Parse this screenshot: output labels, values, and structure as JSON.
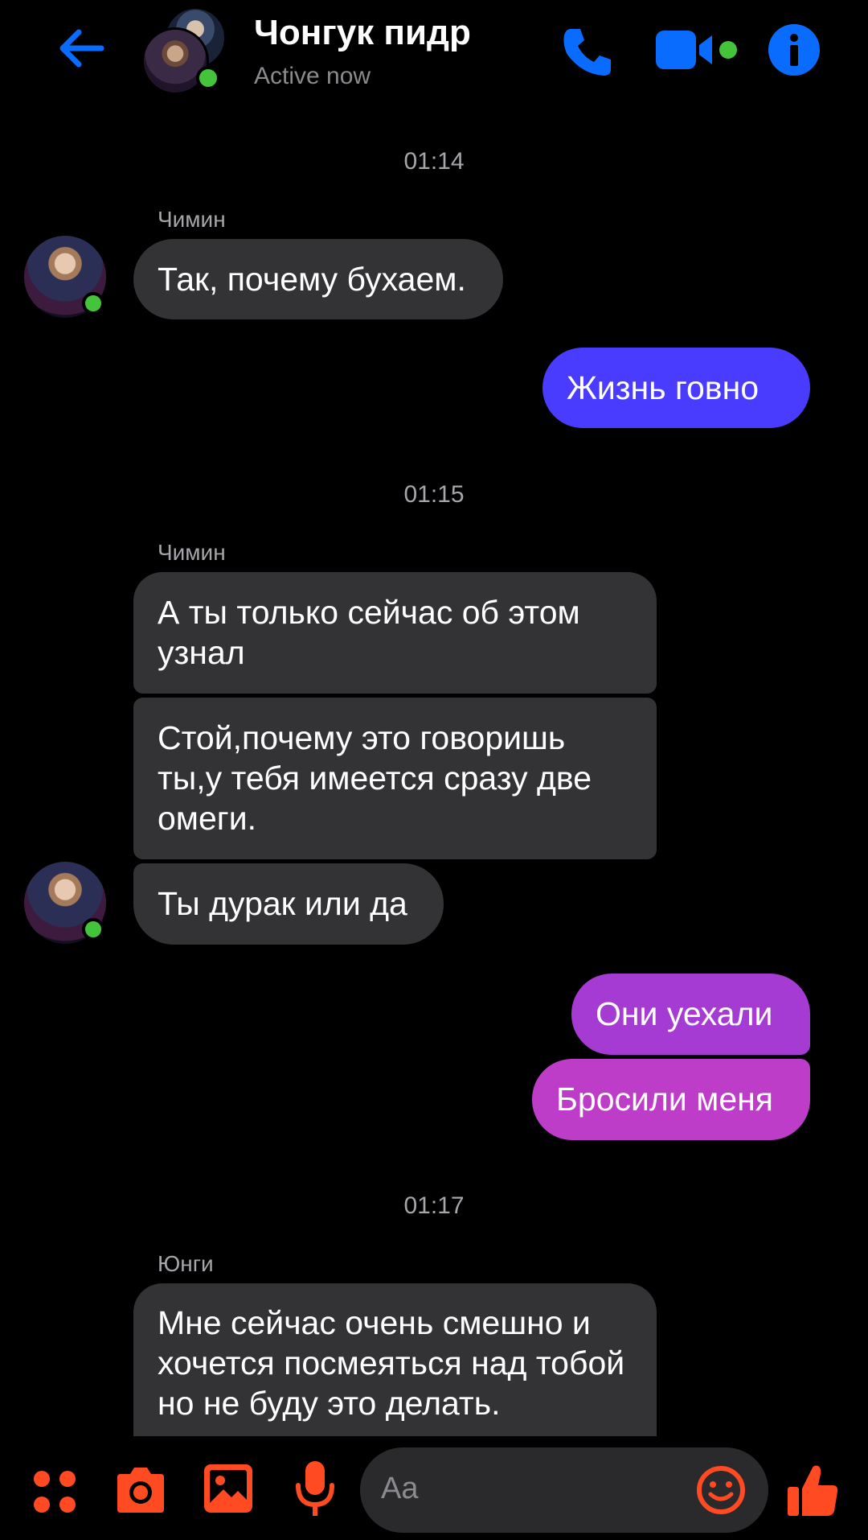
{
  "header": {
    "title": "Чонгук пидр",
    "status": "Active now"
  },
  "messages": {
    "t1": "01:14",
    "s1": "Чимин",
    "m1": "Так, почему бухаем.",
    "m2": "Жизнь говно",
    "t2": "01:15",
    "s2": "Чимин",
    "m3": "А ты только сейчас об этом узнал",
    "m4": "Стой,почему это говоришь ты,у тебя имеется сразу две омеги.",
    "m5": "Ты дурак или да",
    "m6": "Они уехали",
    "m7": "Бросили меня",
    "t3": "01:17",
    "s3": "Юнги",
    "m8": "Мне сейчас очень смешно и хочется посмеяться над тобой но не буду это делать."
  },
  "composer": {
    "placeholder": "Aa"
  },
  "colors": {
    "accent_blue": "#0a6cff",
    "composer_icons": "#ff4a22",
    "bubble_in": "#333336",
    "bubble_out_blue": "#4a3cff",
    "bubble_out_purple": "#b13bd6",
    "online_dot": "#44c43a"
  },
  "icons": {
    "back": "arrow-left-icon",
    "call": "phone-icon",
    "video": "video-camera-icon",
    "info": "info-icon",
    "menu": "four-dots-icon",
    "camera": "camera-icon",
    "gallery": "image-icon",
    "mic": "microphone-icon",
    "emoji": "smiley-icon",
    "like": "thumbs-up-icon"
  }
}
